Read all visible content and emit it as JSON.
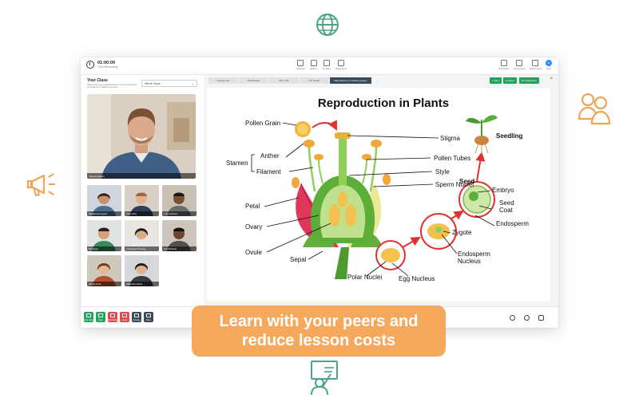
{
  "session": {
    "timer": "01:00:00",
    "timer_sub": "Time Remaining"
  },
  "topbar": {
    "layout_tools": [
      "Fullview",
      "Gallery",
      "Tri-Row",
      "Quad Row"
    ],
    "right_tools": [
      "Calculator",
      "Screenshot",
      "Board View"
    ],
    "user_initial": "U",
    "user_label": "User"
  },
  "class_panel": {
    "title": "Your Class",
    "description": "Select with your optional class to see the progress for students in different groups",
    "selected_class": "Whole Class"
  },
  "main_video": {
    "name": "David Lawson"
  },
  "participants": [
    "Natasha Dominguez",
    "Thom Kirby",
    "T-Jay Karlsson",
    "Bob Boyer",
    "Chris Evans Thomas",
    "Tom Richards",
    "Ali Kay Annie",
    "Nakeisha Kirkova"
  ],
  "content": {
    "tabs": [
      "Garage Fair",
      "Whiteboard",
      "Slim Title",
      "3rd Grade",
      "Reproduction in Plants Lesson"
    ],
    "active_tab_index": 4,
    "buttons": [
      "+ New",
      "⊙ Open",
      "⊕ Collaborate"
    ],
    "close": "×"
  },
  "slide": {
    "title": "Reproduction in Plants",
    "labels": {
      "pollen_grain": "Pollen Grain",
      "stigma": "Stigma",
      "seedling": "Seedling",
      "stamen": "Stamen",
      "anther": "Anther",
      "filament": "Filament",
      "pollen_tubes": "Pollen Tubes",
      "style": "Style",
      "sperm_nuclei": "Sperm Nuclei",
      "seed": "Seed",
      "embryo": "Embryo",
      "seed_coat": "Seed Coat",
      "endosperm": "Endosperm",
      "petal": "Petal",
      "ovary": "Ovary",
      "ovule": "Ovule",
      "sepal": "Sepal",
      "zygote": "Zygote",
      "endosperm_nucleus": "Endosperm Nucleus",
      "polar_nuclei": "Polar Nuclei",
      "egg_nucleus": "Egg Nucleus"
    }
  },
  "controls": [
    {
      "label": "Stop Video",
      "color": "#22a45d"
    },
    {
      "label": "Mute",
      "color": "#22a45d"
    },
    {
      "label": "Stop Share",
      "color": "#e24b4b"
    },
    {
      "label": "Leave",
      "color": "#e24b4b"
    },
    {
      "label": "Settings",
      "color": "#3b4a5a"
    },
    {
      "label": "More",
      "color": "#3b4a5a"
    }
  ],
  "tagline": {
    "line1": "Learn with your peers and",
    "line2": "reduce lesson costs"
  },
  "colors": {
    "accent_orange": "#f6a95d",
    "deco_green": "#4aa58a",
    "deco_orange": "#f0a455",
    "slide_bg": "#f3f4f6",
    "active_tab": "#3b4a5a",
    "green_button": "#22a45d"
  }
}
